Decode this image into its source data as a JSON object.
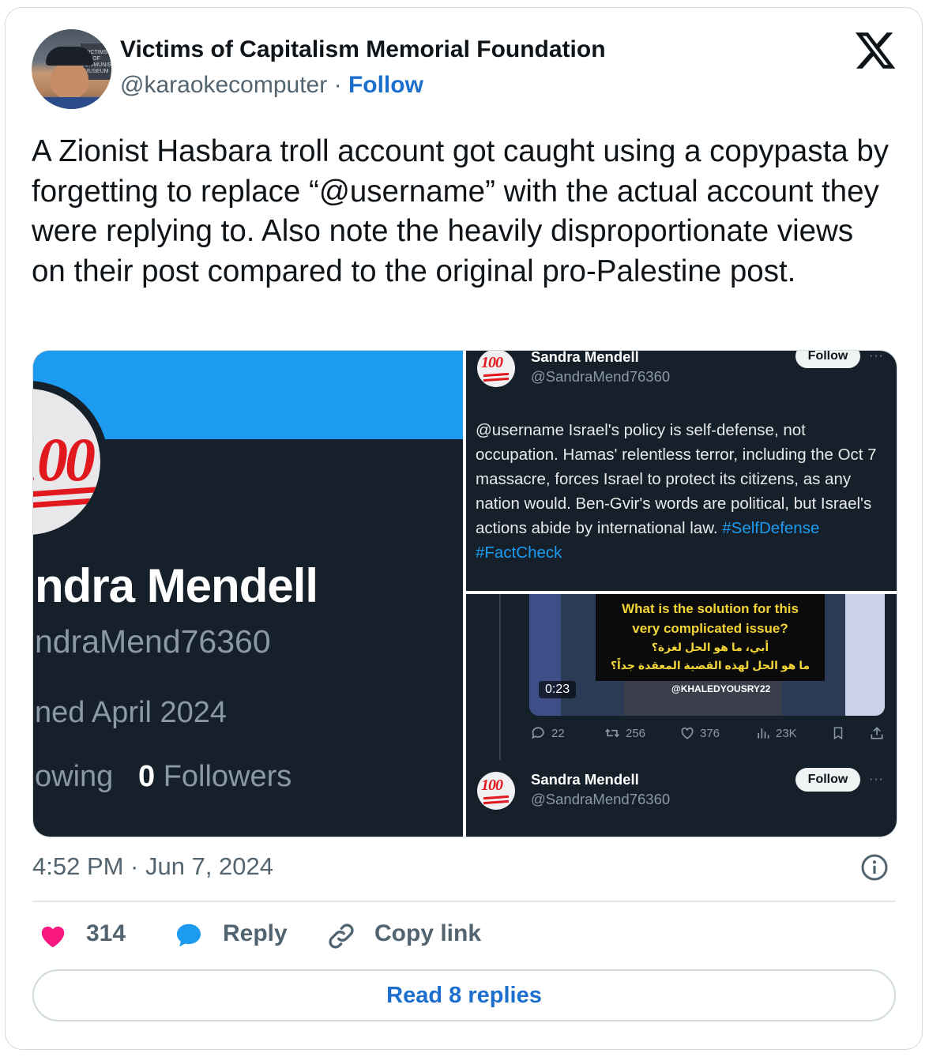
{
  "author": {
    "name": "Victims of Capitalism Memorial Foundation",
    "handle": "@karaokecomputer",
    "separator": "·",
    "follow_label": "Follow",
    "avatar_sign_text": "VICTIMS OF COMMUNISM MUSEUM"
  },
  "tweet": {
    "text": "A Zionist Hasbara troll account got caught using a copypasta by forgetting to replace “@username” with the actual account they were replying to. Also note the heavily disproportionate views on their post compared to the original pro-Palestine post."
  },
  "media": {
    "profile": {
      "avatar_emoji_text": "100",
      "name": "ndra Mendell",
      "handle": "ndraMend76360",
      "joined": "ned April 2024",
      "following_label": "owing",
      "followers_count": "0",
      "followers_label": "Followers"
    },
    "reply_post": {
      "avatar_emoji_text": "100",
      "name": "Sandra Mendell",
      "handle": "@SandraMend76360",
      "follow_label": "Follow",
      "more": "···",
      "text": "@username Israel's policy is self-defense, not occupation. Hamas' relentless terror, including the Oct 7 massacre, forces Israel to protect its citizens, as any nation would. Ben-Gvir's words are political, but Israel's actions abide by international law.",
      "hashtags": "#SelfDefense #FactCheck"
    },
    "video_post": {
      "caption_en_1": "What is the solution for this",
      "caption_en_2": "very complicated issue?",
      "caption_ar_1": "أبي، ما هو الحل لغزة؟",
      "caption_ar_2": "ما هو الحل لهذه القضية المعقدة جداً؟",
      "watermark": "@KHALEDYOUSRY22",
      "duration": "0:23",
      "replies": "22",
      "reposts": "256",
      "likes": "376",
      "views": "23K"
    },
    "bottom_post": {
      "avatar_emoji_text": "100",
      "name": "Sandra Mendell",
      "handle": "@SandraMend76360",
      "follow_label": "Follow",
      "more": "···"
    }
  },
  "meta": {
    "timestamp": "4:52 PM · Jun 7, 2024"
  },
  "actions": {
    "like_count": "314",
    "reply_label": "Reply",
    "copy_label": "Copy link",
    "read_replies_label": "Read 8 replies"
  },
  "colors": {
    "link_blue": "#1d6fce",
    "like_pink": "#f91880",
    "reply_blue": "#1d9bf0",
    "dark_panel": "#16202a"
  }
}
